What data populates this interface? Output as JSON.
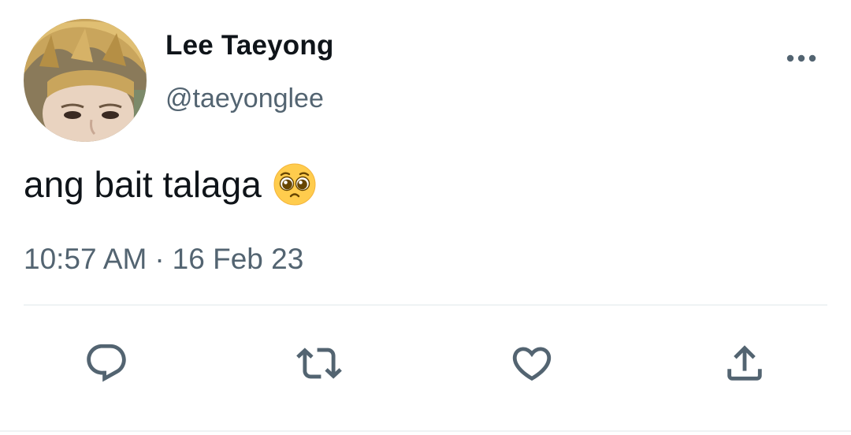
{
  "tweet": {
    "display_name": "Lee Taeyong",
    "handle": "@taeyonglee",
    "text": "ang bait talaga",
    "emoji": "pleading-face",
    "time": "10:57 AM",
    "separator": "·",
    "date": "16 Feb 23"
  },
  "icons": {
    "more": "more-horizontal-icon",
    "reply": "reply-icon",
    "retweet": "retweet-icon",
    "like": "heart-icon",
    "share": "share-icon"
  },
  "colors": {
    "primary_text": "#0f1419",
    "secondary_text": "#536471",
    "divider": "#eff3f4"
  }
}
